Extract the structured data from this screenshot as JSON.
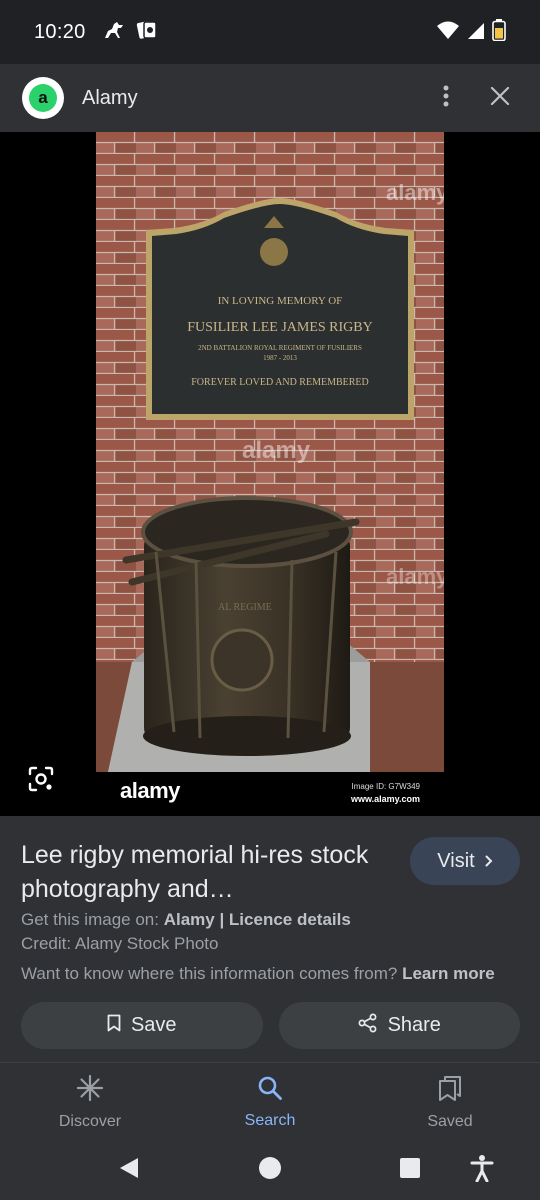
{
  "status_bar": {
    "time": "10:20",
    "left_icons": [
      "horse-notification-icon",
      "cards-notification-icon"
    ],
    "right_icons": [
      "wifi-icon",
      "cell-signal-icon",
      "battery-icon"
    ]
  },
  "header": {
    "site_logo_letter": "a",
    "site_name": "Alamy",
    "icons": [
      "more-vert-icon",
      "close-icon"
    ]
  },
  "image": {
    "watermark": "alamy",
    "plaque_line1": "IN LOVING MEMORY OF",
    "plaque_line2": "FUSILIER LEE JAMES RIGBY",
    "plaque_line3": "2ND BATTALION ROYAL REGIMENT OF FUSILIERS",
    "plaque_line4": "1987 - 2013",
    "plaque_line5": "FOREVER LOVED AND REMEMBERED",
    "drum_text": "AL REGIME",
    "footer_logo": "alamy",
    "image_id": "Image ID: G7W349",
    "image_url": "www.alamy.com"
  },
  "info": {
    "title": "Lee rigby memorial hi-res stock photography and…",
    "visit_label": "Visit",
    "get_image_prefix": "Get this image on: ",
    "get_image_source": "Alamy",
    "separator": " | ",
    "licence_label": "Licence details",
    "credit": "Credit: Alamy Stock Photo",
    "info_question": "Want to know where this information comes from? ",
    "learn_more": "Learn more",
    "save_label": "Save",
    "share_label": "Share"
  },
  "bottom_nav": {
    "items": [
      {
        "label": "Discover",
        "icon": "asterisk-icon",
        "active": false
      },
      {
        "label": "Search",
        "icon": "search-icon",
        "active": true
      },
      {
        "label": "Saved",
        "icon": "collections-icon",
        "active": false
      }
    ]
  },
  "system_nav": [
    "back-icon",
    "home-icon",
    "recents-icon",
    "accessibility-icon"
  ],
  "colors": {
    "background": "#202124",
    "surface": "#303134",
    "active_blue": "#8ab4f8",
    "visit_button": "#394457",
    "logo_green": "#2bd16b"
  }
}
